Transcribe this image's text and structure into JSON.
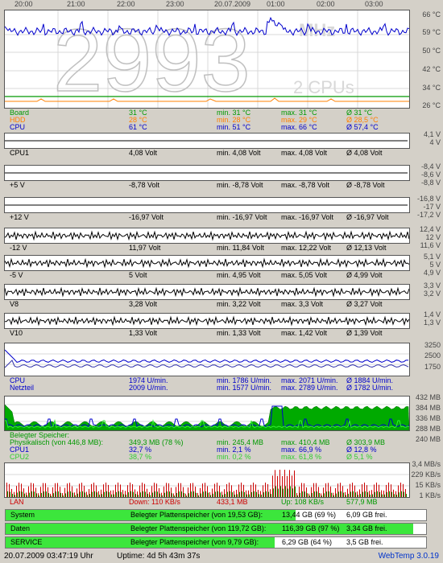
{
  "top_times": [
    "20:00",
    "21:00",
    "22:00",
    "23:00",
    "20.07.2009",
    "01:00",
    "02:00",
    "03:00"
  ],
  "colors": {
    "board": "#009900",
    "hdd": "#ff8000",
    "cpu": "#0000cc",
    "lan_down": "#cc0000",
    "lan_up": "#009900",
    "mem_fill": "#00aa00",
    "disk_fill": "#3ce63c",
    "status_blue": "#0033cc"
  },
  "watermark": {
    "big": "2993",
    "mhz": "MHz",
    "cpus": "2 CPUs"
  },
  "temp": {
    "right_labels": [
      "66 °C",
      "59 °C",
      "50 °C",
      "42 °C",
      "34 °C",
      "26 °C"
    ],
    "rows": [
      {
        "name": "Board",
        "value": "31 °C",
        "min": "min. 31 °C",
        "max": "max. 31 °C",
        "avg": "Ø 31 °C"
      },
      {
        "name": "HDD",
        "value": "28 °C",
        "min": "min. 28 °C",
        "max": "max. 29 °C",
        "avg": "Ø 28,5 °C"
      },
      {
        "name": "CPU",
        "value": "61 °C",
        "min": "min. 51 °C",
        "max": "max. 66 °C",
        "avg": "Ø 57,4 °C"
      }
    ]
  },
  "volt": [
    {
      "right_labels": [
        "4,1 V",
        "4 V"
      ],
      "row": {
        "name": "CPU1",
        "value": "4,08 Volt",
        "min": "min. 4,08 Volt",
        "max": "max. 4,08 Volt",
        "avg": "Ø 4,08 Volt"
      }
    },
    {
      "right_labels": [
        "-8,4 V",
        "-8,6 V",
        "-8,8 V"
      ],
      "row": {
        "name": "+5 V",
        "value": "-8,78 Volt",
        "min": "min. -8,78 Volt",
        "max": "max. -8,78 Volt",
        "avg": "Ø -8,78 Volt"
      }
    },
    {
      "right_labels": [
        "-16,8 V",
        "-17 V",
        "-17,2 V"
      ],
      "row": {
        "name": "+12 V",
        "value": "-16,97 Volt",
        "min": "min. -16,97 Volt",
        "max": "max. -16,97 Volt",
        "avg": "Ø -16,97 Volt"
      }
    },
    {
      "right_labels": [
        "12,4 V",
        "12 V",
        "11,6 V"
      ],
      "row": {
        "name": "-12 V",
        "value": "11,97 Volt",
        "min": "min. 11,84 Volt",
        "max": "max. 12,22 Volt",
        "avg": "Ø 12,13 Volt"
      }
    },
    {
      "right_labels": [
        "5,1 V",
        "5 V",
        "4,9 V"
      ],
      "row": {
        "name": "-5 V",
        "value": "5 Volt",
        "min": "min. 4,95 Volt",
        "max": "max. 5,05 Volt",
        "avg": "Ø 4,99 Volt"
      }
    },
    {
      "right_labels": [
        "3,3 V",
        "3,2 V"
      ],
      "row": {
        "name": "V8",
        "value": "3,28 Volt",
        "min": "min. 3,22 Volt",
        "max": "max. 3,3 Volt",
        "avg": "Ø 3,27 Volt"
      }
    },
    {
      "right_labels": [
        "1,4 V",
        "1,3 V"
      ],
      "row": {
        "name": "V10",
        "value": "1,33 Volt",
        "min": "min. 1,33 Volt",
        "max": "max. 1,42 Volt",
        "avg": "Ø 1,39 Volt"
      }
    }
  ],
  "fan": {
    "right_labels": [
      "3250",
      "2500",
      "1750"
    ],
    "rows": [
      {
        "name": "CPU",
        "value": "1974 U/min.",
        "min": "min. 1786 U/min.",
        "max": "max. 2071 U/min.",
        "avg": "Ø 1884 U/min."
      },
      {
        "name": "Netzteil",
        "value": "2009 U/min.",
        "min": "min. 1577 U/min.",
        "max": "max. 2789 U/min.",
        "avg": "Ø 1782 U/min."
      }
    ]
  },
  "mem": {
    "right_labels": [
      "432 MB",
      "384 MB",
      "336 MB",
      "288 MB",
      "240 MB"
    ],
    "header": "Belegter Speicher:",
    "rows": [
      {
        "name": "Physikalisch (von 446,8 MB):",
        "value": "349,3 MB (78 %)",
        "min": "min. 245,4 MB",
        "max": "max. 410,4 MB",
        "avg": "Ø 303,9 MB"
      },
      {
        "name": "CPU1",
        "value": "32,7 %",
        "min": "min. 2,1 %",
        "max": "max. 66,9 %",
        "avg": "Ø 12,8 %"
      },
      {
        "name": "CPU2",
        "value": "38,7 %",
        "min": "min. 0,2 %",
        "max": "max. 61,8 %",
        "avg": "Ø 5,1 %"
      }
    ]
  },
  "lan": {
    "right_labels": [
      "3,4 MB/s",
      "229 KB/s",
      "15 KB/s",
      "1 KB/s"
    ],
    "name": "LAN",
    "down": "Down: 110 KB/s",
    "down_total": "433,1 MB",
    "up": "Up: 108 KB/s",
    "up_total": "577,9 MB"
  },
  "disks": [
    {
      "name": "System",
      "label": "Belegter Plattenspeicher (von 19,53 GB):",
      "used": "13,44 GB (69 %)",
      "free": "6,09 GB frei.",
      "percent": 69
    },
    {
      "name": "Daten",
      "label": "Belegter Plattenspeicher (von 119,72 GB):",
      "used": "116,39 GB (97 %)",
      "free": "3,34 GB frei.",
      "percent": 97
    },
    {
      "name": "SERVICE",
      "label": "Belegter Plattenspeicher (von 9,79 GB):",
      "used": "6,29 GB (64 %)",
      "free": "3,5 GB frei.",
      "percent": 64
    }
  ],
  "status": {
    "datetime": "20.07.2009 03:47:19 Uhr",
    "uptime": "Uptime: 4d 5h 43m 37s",
    "app": "WebTemp 3.0.19"
  }
}
